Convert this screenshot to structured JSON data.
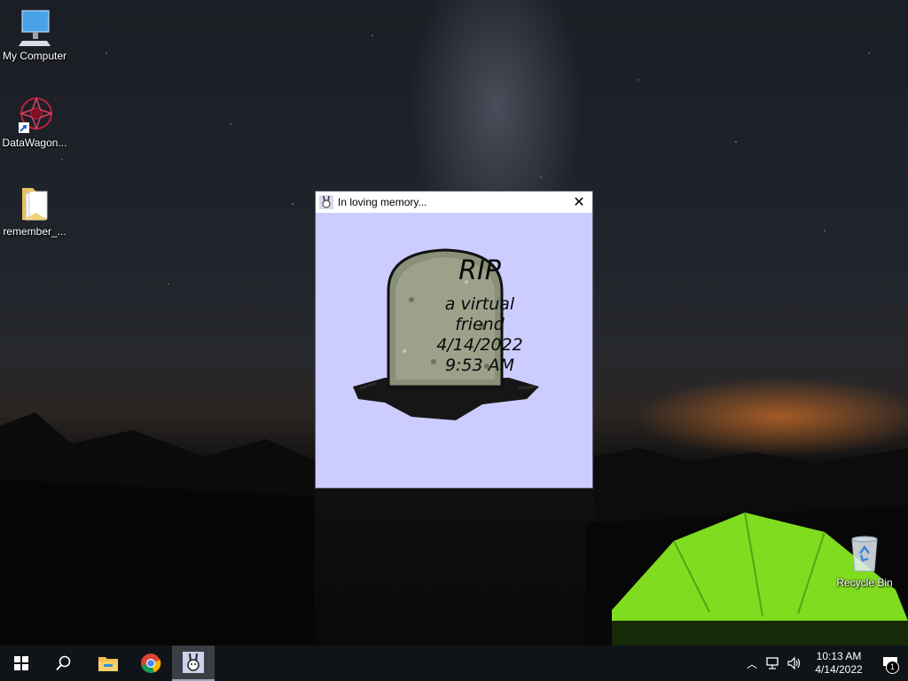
{
  "desktop": {
    "icons": [
      {
        "label": "My Computer",
        "icon": "computer-icon"
      },
      {
        "label": "DataWagon...",
        "icon": "datawagon-shortcut-icon"
      },
      {
        "label": "remember_...",
        "icon": "folder-icon"
      },
      {
        "label": "Recycle Bin",
        "icon": "recycle-bin-icon"
      }
    ]
  },
  "dialog": {
    "title": "In loving memory...",
    "close_symbol": "✕",
    "headstone": {
      "heading": "RIP",
      "line1": "a virtual",
      "line2": "friend",
      "date": "4/14/2022",
      "time": "9:53 AM"
    }
  },
  "taskbar": {
    "items": [
      {
        "name": "start-button",
        "icon": "windows-logo-icon"
      },
      {
        "name": "search-button",
        "icon": "search-icon"
      },
      {
        "name": "file-explorer",
        "icon": "folder-icon"
      },
      {
        "name": "chrome",
        "icon": "chrome-icon"
      },
      {
        "name": "memorial-app",
        "icon": "bunny-icon",
        "active": true
      }
    ],
    "tray": {
      "clock_time": "10:13 AM",
      "clock_date": "4/14/2022",
      "notification_count": "1"
    }
  }
}
